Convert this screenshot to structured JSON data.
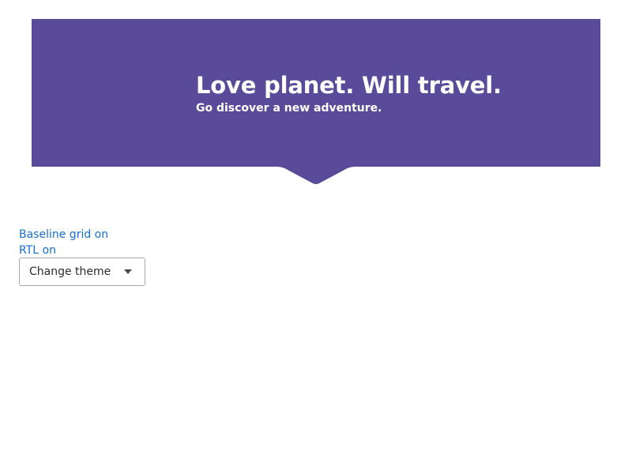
{
  "hero": {
    "title": "Love planet. Will travel.",
    "subtitle": "Go discover a new adventure.",
    "background_color": "#5a4a9a"
  },
  "controls": {
    "baseline_grid_label": "Baseline grid on",
    "rtl_label": "RTL on",
    "theme_dropdown_label": "Change theme",
    "link_color": "#1670d4",
    "dropdown_icon": "caret-down-icon"
  }
}
